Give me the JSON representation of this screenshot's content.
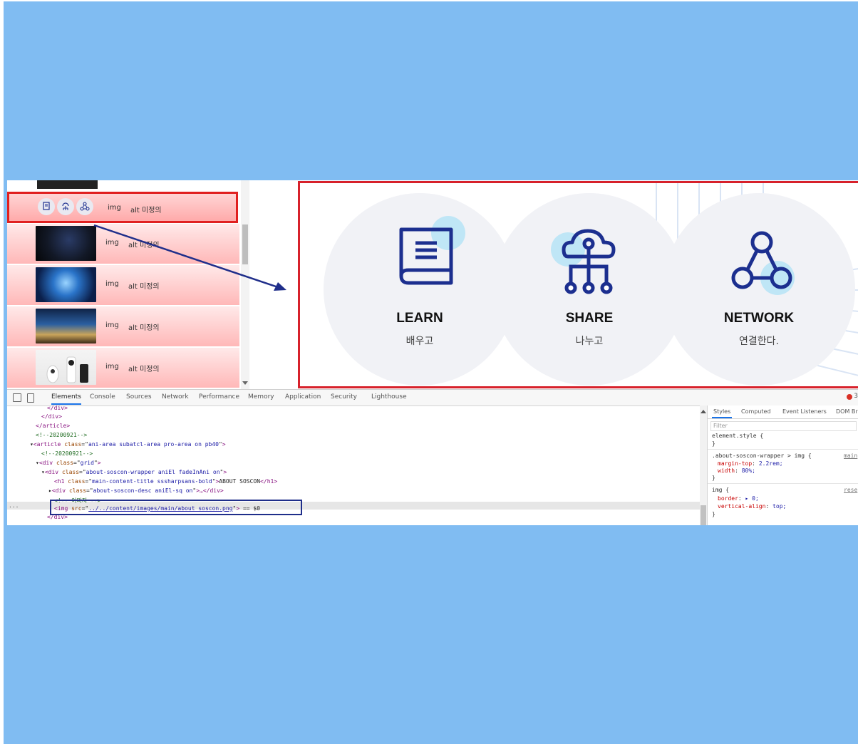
{
  "image_list": {
    "rows": [
      {
        "type": "img",
        "alt": "alt 미정의"
      },
      {
        "type": "img",
        "alt": "alt 미정의"
      },
      {
        "type": "img",
        "alt": "alt 미정의"
      },
      {
        "type": "img",
        "alt": "alt 미정의"
      },
      {
        "type": "img",
        "alt": "alt 미정의"
      }
    ]
  },
  "preview": {
    "items": [
      {
        "title": "LEARN",
        "subtitle": "배우고",
        "icon": "book-icon"
      },
      {
        "title": "SHARE",
        "subtitle": "나누고",
        "icon": "cloud-network-icon"
      },
      {
        "title": "NETWORK",
        "subtitle": "연결한다.",
        "icon": "network-nodes-icon"
      }
    ]
  },
  "devtools": {
    "tabs": [
      "Elements",
      "Console",
      "Sources",
      "Network",
      "Performance",
      "Memory",
      "Application",
      "Security",
      "Lighthouse"
    ],
    "active_tab": "Elements",
    "error_count": "3",
    "code": {
      "l1": "</div>",
      "l2": "</div>",
      "l3": "</article>",
      "l4": "<!--20200921-->",
      "l5_tag": "article",
      "l5_class": "ani-area subatcl-area pro-area on pb40",
      "l6": "<!--20200921-->",
      "l7_tag": "div",
      "l7_class": "grid",
      "l8_tag": "div",
      "l8_class": "about-soscon-wrapper aniEl fadeInAni on",
      "l9_tag": "h1",
      "l9_class": "main-content-title sssharpsans-bold",
      "l9_text": "ABOUT SOSCON",
      "l10_tag": "div",
      "l10_class": "about-soscon-desc aniEl-sq on",
      "l10_rest": "…</div>",
      "l11": "<!-- 이미지 -->",
      "l12_tag": "img",
      "l12_src": "../../content/images/main/about_soscon.png",
      "l12_suffix": "== $0",
      "l13": "</div>",
      "ellipsis": "..."
    },
    "styles": {
      "tabs": [
        "Styles",
        "Computed",
        "Event Listeners",
        "DOM Br"
      ],
      "filter_placeholder": "Filter",
      "element_style": "element.style {",
      "close": "}",
      "rule1_selector": ".about-soscon-wrapper > img {",
      "rule1_source": "main",
      "rule1_prop1": "margin-top",
      "rule1_val1": "2.2rem;",
      "rule1_prop2": "width",
      "rule1_val2": "80%;",
      "rule2_selector": "img {",
      "rule2_source": "rese",
      "rule2_prop1": "border",
      "rule2_val1": "▸ 0;",
      "rule2_prop2": "vertical-align",
      "rule2_val2": "top;"
    }
  },
  "colors": {
    "background": "#80bcf2",
    "highlight_red": "#d7212b",
    "highlight_navy": "#1f2e8a",
    "icon_navy": "#1c2f8f",
    "icon_accent": "#bfe6f6"
  }
}
